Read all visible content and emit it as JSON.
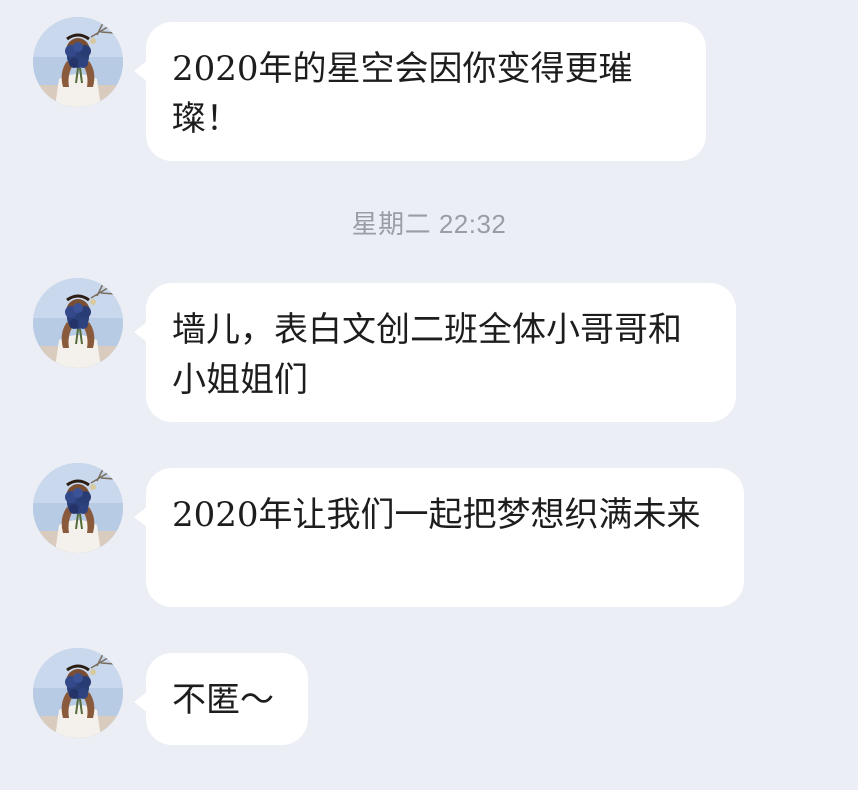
{
  "messages": [
    {
      "text": "2020年的星空会因你变得更璀璨！"
    },
    {
      "text": "墙儿，表白文创二班全体小哥哥和小姐姐们"
    },
    {
      "text": "2020年让我们一起把梦想织满未来"
    },
    {
      "text": "不匿～"
    }
  ],
  "timestamp": "星期二 22:32",
  "colors": {
    "background": "#eceef6",
    "bubble": "#ffffff",
    "text": "#1d1d1d",
    "timestamp": "#9a9ca6"
  },
  "icons": {
    "avatar": "user-avatar-icon"
  }
}
